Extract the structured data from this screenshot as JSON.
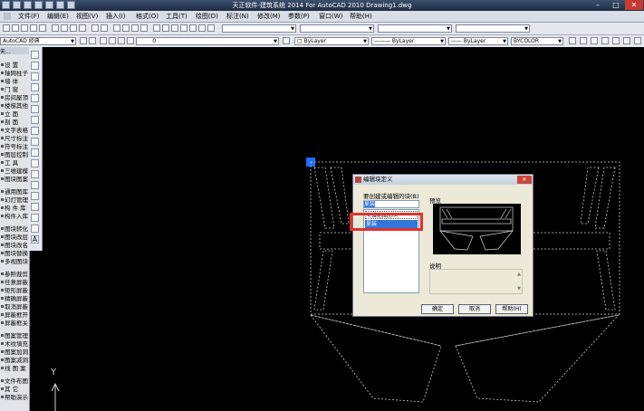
{
  "titlebar": {
    "title": "天正软件-建筑系统 2014  For AutoCAD 2010        Drawing1.dwg",
    "minimize": "–",
    "maximize": "□",
    "close": "✕"
  },
  "menubar": {
    "items": [
      "文件(F)",
      "编辑(E)",
      "视图(V)",
      "插入(I)",
      "格式(O)",
      "工具(T)",
      "绘图(D)",
      "标注(N)",
      "修改(M)",
      "参数(P)",
      "窗口(W)",
      "帮助(H)"
    ]
  },
  "toolbar2": {
    "workspace": "AutoCAD 经典",
    "layer": "0",
    "color": "ByLayer",
    "linetype": "ByLayer",
    "lineweight": "ByLayer",
    "plotstyle": "BYCOLOR"
  },
  "leftpanel": {
    "header": "天...",
    "items": [
      "设  置",
      "轴网柱子",
      "墙  体",
      "门  窗",
      "房间屋顶",
      "楼梯其他",
      "立  面",
      "剖  面",
      "文字表格",
      "尺寸标注",
      "符号标注",
      "图层控制",
      "工  具",
      "三维建模",
      "图块图案",
      "通用图库",
      "幻灯管理",
      "构 件 库",
      "构件入库",
      "图块转化",
      "图块改层",
      "图块改名",
      "图块替换",
      "多视图块",
      "参照裁剪",
      "任意屏蔽",
      "矩形屏蔽",
      "精确屏蔽",
      "取消屏蔽",
      "屏蔽框开",
      "屏蔽框关",
      "图案管理",
      "木纹填充",
      "图案加洞",
      "图案减洞",
      "线 图 案",
      "文件布图",
      "其  它",
      "帮助演示"
    ]
  },
  "ucs": {
    "y_label": "Y"
  },
  "dialog": {
    "title": "编辑块定义",
    "list_label": "要创建或编辑的块(B)",
    "input_value": "夏装",
    "list_items": [
      "<当前图形>",
      "夏装"
    ],
    "preview_label": "预览",
    "description_label": "说明",
    "ok": "确定",
    "cancel": "取消",
    "help": "帮助(H)"
  },
  "colors": {
    "highlight_box": "#e0342e",
    "selection": "#3176d8",
    "grip": "#1a6fff"
  }
}
